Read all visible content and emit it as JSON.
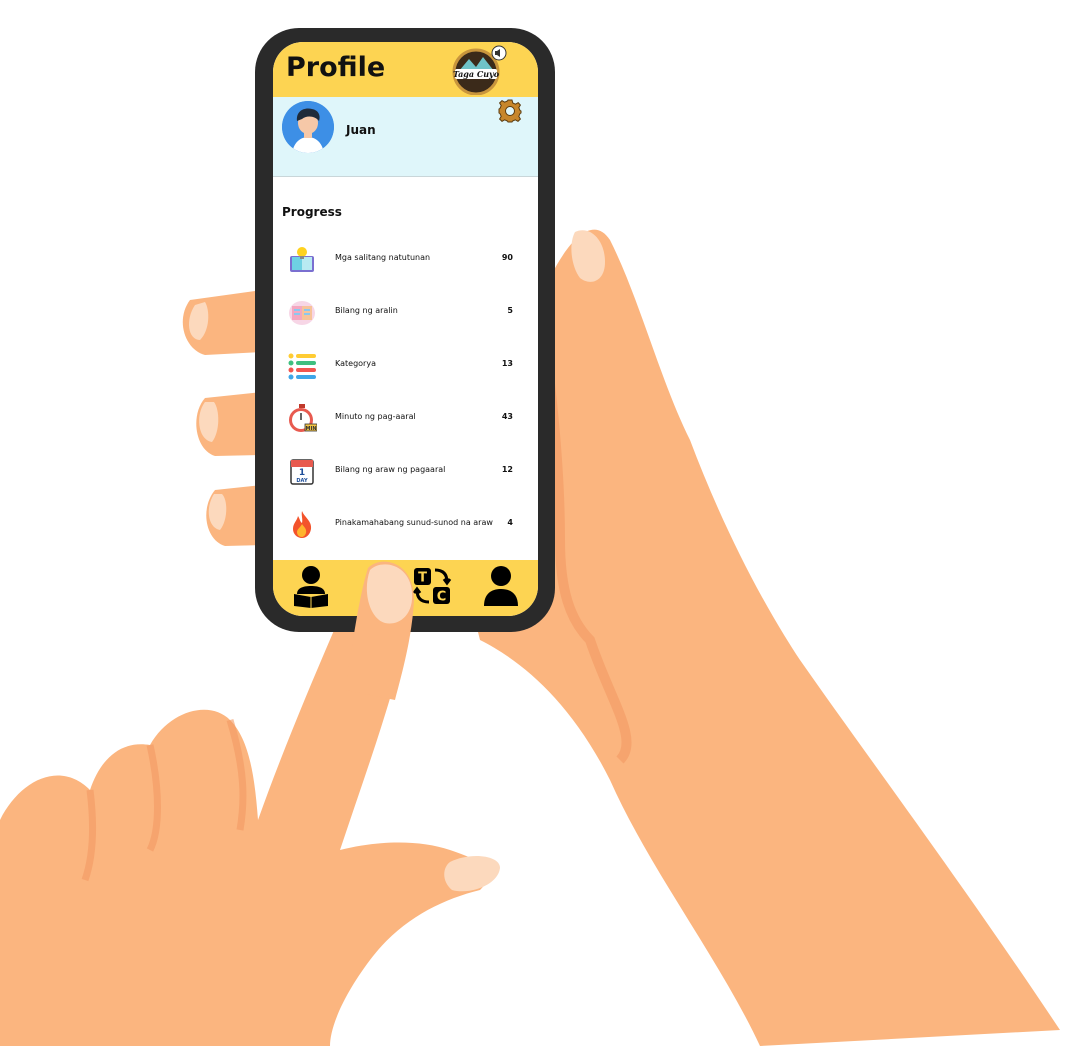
{
  "header": {
    "title": "Profile",
    "logo_text": "Taga Cuyo"
  },
  "user": {
    "name": "Juan"
  },
  "progress": {
    "title": "Progress",
    "stats": [
      {
        "icon": "book-lightbulb-icon",
        "label": "Mga salitang natutunan",
        "value": "90"
      },
      {
        "icon": "lesson-book-icon",
        "label": "Bilang ng aralin",
        "value": "5"
      },
      {
        "icon": "category-list-icon",
        "label": "Kategorya",
        "value": "13"
      },
      {
        "icon": "stopwatch-icon",
        "label": "Minuto ng pag-aaral",
        "value": "43"
      },
      {
        "icon": "calendar-day-icon",
        "label": "Bilang ng araw ng pagaaral",
        "value": "12"
      },
      {
        "icon": "fire-icon",
        "label": "Pinakamahabang sunud-sunod na araw",
        "value": "4"
      }
    ]
  },
  "nav": {
    "items": [
      {
        "icon": "learner-reading-icon"
      },
      {
        "icon": "translate-tc-icon",
        "letters": [
          "T",
          "C"
        ]
      },
      {
        "icon": "profile-person-icon"
      }
    ]
  },
  "colors": {
    "accent": "#fdd452",
    "user_panel": "#dff6fa",
    "skin": "#fbb57f",
    "phone": "#2a2a2a"
  }
}
